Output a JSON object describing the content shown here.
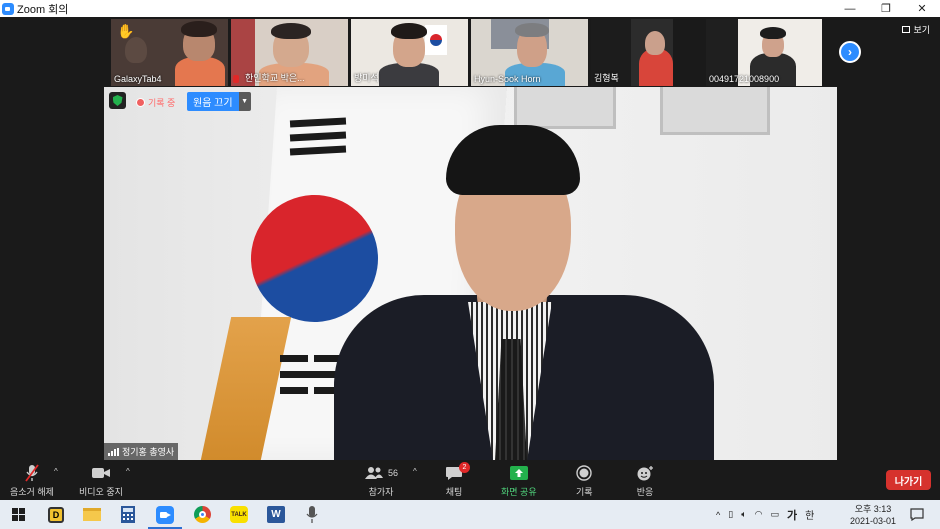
{
  "window": {
    "title": "Zoom 회의",
    "minimize": "—",
    "restore": "❐",
    "close": "✕"
  },
  "header": {
    "view_label": "보기"
  },
  "participants": [
    {
      "name": "GalaxyTab4",
      "raised_hand": true
    },
    {
      "name": "한인학교 박은...",
      "muted": true
    },
    {
      "name": "방미석"
    },
    {
      "name": "Hyun-Sook Horn"
    },
    {
      "name": "김형복"
    },
    {
      "name": "00491721008900"
    }
  ],
  "main_video": {
    "recording_label": "기록 중",
    "remote_control_label": "원음 끄기",
    "speaker_name": "정기홍 총영사"
  },
  "toolbar": {
    "unmute_label": "음소거 해제",
    "stop_video_label": "비디오 중지",
    "participants_label": "참가자",
    "participants_count": "56",
    "chat_label": "채팅",
    "chat_badge": "2",
    "share_label": "화면 공유",
    "record_label": "기록",
    "reactions_label": "반응",
    "leave_label": "나가기"
  },
  "taskbar": {
    "ime_label": "가",
    "ime2_label": "한",
    "time": "오후 3:13",
    "date": "2021-03-01"
  },
  "colors": {
    "zoom_blue": "#2d8cff",
    "leave_red": "#d6322d",
    "share_green": "#23b14d"
  }
}
